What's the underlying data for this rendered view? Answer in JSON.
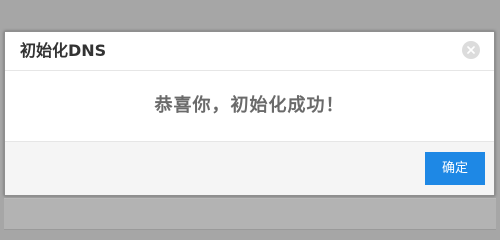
{
  "dialog": {
    "title": "初始化DNS",
    "close_icon": "close-icon",
    "message": "恭喜你，初始化成功！",
    "confirm_label": "确定"
  },
  "colors": {
    "backdrop": "#a6a6a6",
    "accent": "#1e88e5",
    "message_text": "#6a6a6a",
    "footer_bg": "#f5f5f5"
  }
}
